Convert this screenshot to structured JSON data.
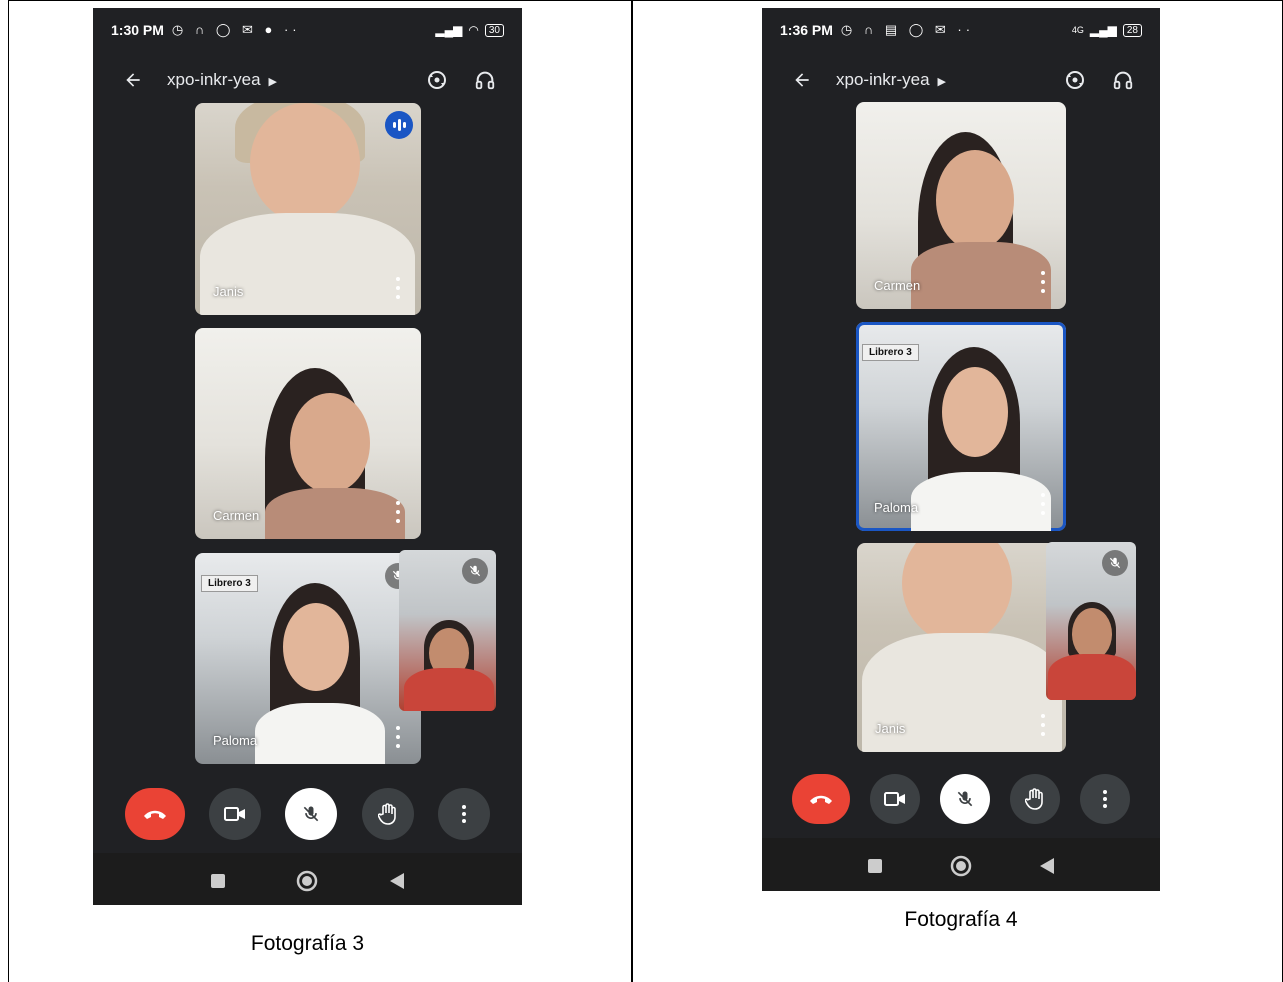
{
  "screenshots": [
    {
      "status": {
        "time": "1:30 PM",
        "battery": "30"
      },
      "meeting_code": "xpo-inkr-yea",
      "tiles": [
        {
          "name": "Janis"
        },
        {
          "name": "Carmen"
        },
        {
          "name": "Paloma",
          "sign_text": "Librero 3"
        }
      ],
      "caption": "Fotografía 3"
    },
    {
      "status": {
        "time": "1:36 PM",
        "battery": "28",
        "network": "4G"
      },
      "meeting_code": "xpo-inkr-yea",
      "tiles": [
        {
          "name": "Carmen"
        },
        {
          "name": "Paloma",
          "sign_text": "Librero 3"
        },
        {
          "name": "Janis"
        }
      ],
      "caption": "Fotografía 4"
    }
  ],
  "colors": {
    "end_call": "#ea4335",
    "active_speaker": "#1a56c4",
    "background": "#202124"
  },
  "icons": {
    "back": "arrow-left-icon",
    "switch_camera": "switch-camera-icon",
    "audio": "headphones-icon",
    "end_call": "phone-hangup-icon",
    "camera": "video-camera-icon",
    "mic": "mic-off-icon",
    "hand": "raise-hand-icon",
    "more": "more-vert-icon"
  }
}
